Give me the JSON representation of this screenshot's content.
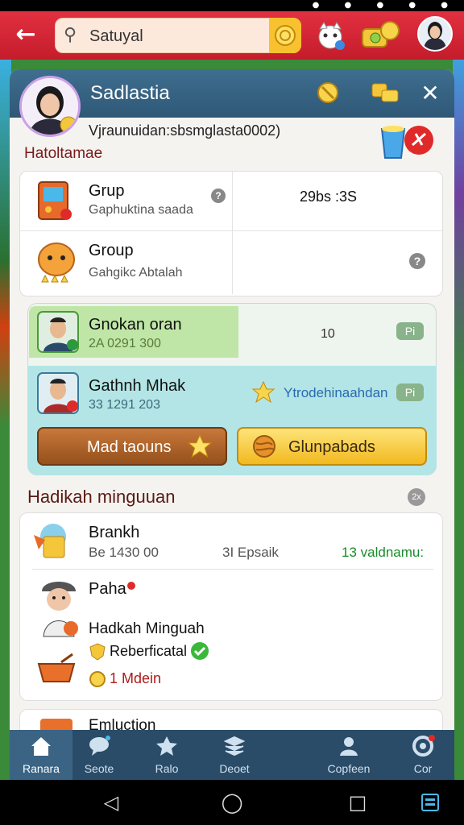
{
  "search": {
    "value": "Satuyal"
  },
  "panel": {
    "title": "Sadlastia",
    "email": "Vjraunuidan:sbsmglasta0002)",
    "subtitle": "Hatoltamae"
  },
  "groups": [
    {
      "label": "Grup",
      "sub": "Gaphuktina saada",
      "value": "29bs :3S"
    },
    {
      "label": "Group",
      "sub": "Gahgikc Abtalah",
      "value": ""
    }
  ],
  "members": [
    {
      "name": "Gnokan oran",
      "id": "2A 0291 300",
      "value": "10",
      "badge": "Pi"
    },
    {
      "name": "Gathnh Mhak",
      "id": "33 1291 203",
      "value": "Ytrodehinaahdan",
      "badge": "Pi"
    }
  ],
  "buttons": {
    "left": "Mad taouns",
    "right": "Glunpabads"
  },
  "section": {
    "title": "Hadikah minguuan",
    "badge": "2x"
  },
  "list": {
    "item1": {
      "title": "Brankh",
      "sub": "Be 1430 00",
      "mid": "3I Epsaik",
      "right": "13 valdnamu:"
    },
    "item2": {
      "title": "Paha"
    },
    "extra_title": "Hadkah Minguah",
    "reward_label": "Reberficatal",
    "cost_label": "1 Mdein"
  },
  "partial_item": {
    "title": "Emluction"
  },
  "nav": {
    "items": [
      {
        "label": "Ranara",
        "icon": "home-icon"
      },
      {
        "label": "Seote",
        "icon": "chat-icon"
      },
      {
        "label": "Ralo",
        "icon": "star-icon"
      },
      {
        "label": "Deoet",
        "icon": "layers-icon"
      },
      {
        "label": "Copfeen",
        "icon": "people-icon"
      },
      {
        "label": "Cor",
        "icon": "settings-icon"
      }
    ]
  },
  "colors": {
    "header": "#d42434",
    "panel_head": "#36627f",
    "accent_green": "#1a8a2a",
    "accent_blue": "#2a6ab0"
  }
}
